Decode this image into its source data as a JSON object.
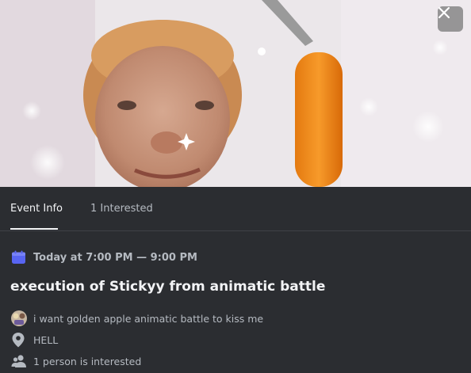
{
  "event": {
    "title": "execution of Stickyy from animatic battle",
    "time": "Today at 7:00 PM — 9:00 PM",
    "host_text": "i want golden apple animatic battle to kiss me",
    "location": "HELL",
    "interested_text": "1 person is interested"
  },
  "tabs": [
    {
      "label": "Event Info",
      "active": true
    },
    {
      "label": "1 Interested",
      "active": false
    }
  ],
  "icons": {
    "close": "close-icon",
    "calendar": "calendar-icon",
    "location": "location-pin-icon",
    "people": "people-icon"
  },
  "colors": {
    "background": "#313338",
    "panel": "#2b2d31",
    "calendar_accent": "#5865f2",
    "muted_text": "#b5bac1",
    "title_text": "#f2f3f5"
  }
}
